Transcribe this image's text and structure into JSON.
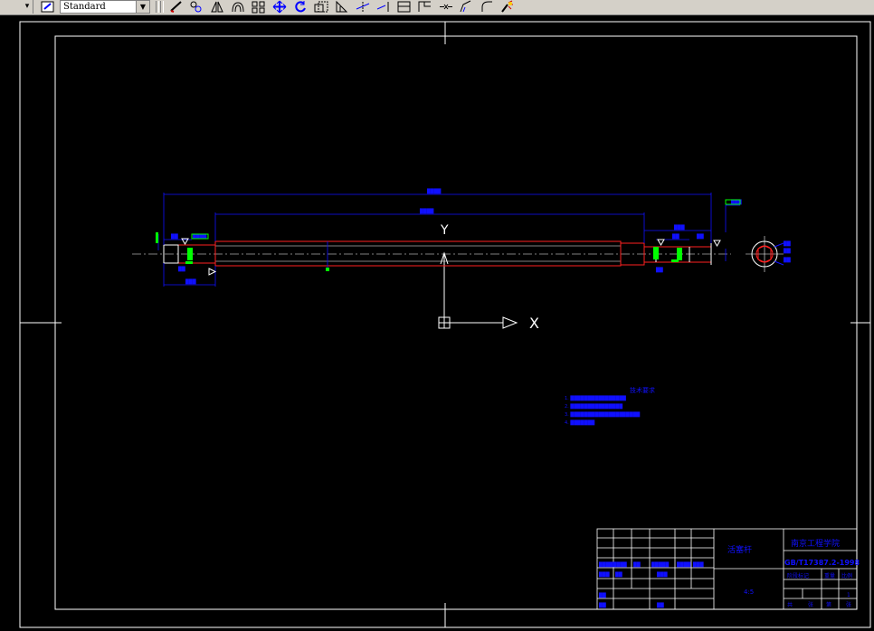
{
  "toolbar": {
    "text_style": "Standard",
    "tools": [
      "edit-icon",
      "copy-icon",
      "mirror-icon",
      "offset-icon",
      "array-icon",
      "move-icon",
      "rotate-icon",
      "scale-icon",
      "stretch-icon",
      "trim-icon",
      "extend-icon",
      "break-icon",
      "break-at-point-icon",
      "join-icon",
      "chamfer-icon",
      "fillet-icon",
      "explode-icon"
    ]
  },
  "ucs": {
    "x_label": "X",
    "y_label": "Y"
  },
  "notes": {
    "title": "技术要求",
    "lines": [
      "1. ████████████████",
      "2. ███████████████",
      "3. ████████████████████",
      "4. ███████"
    ]
  },
  "title_block": {
    "part_name": "活塞杆",
    "school": "南京工程学院",
    "drawing_no": "GB/T17387.2-1998",
    "scale": "4:5",
    "sheet_cols": [
      "阶段标记",
      "重量",
      "比例"
    ],
    "bottom_row": [
      "共",
      "张",
      "第",
      "张"
    ],
    "sheet_value": "1"
  },
  "colors": {
    "accent_blue": "#1010ff",
    "red": "#ff2020",
    "white": "#ffffff",
    "green": "#00ff00",
    "yellow": "#ffff00"
  }
}
